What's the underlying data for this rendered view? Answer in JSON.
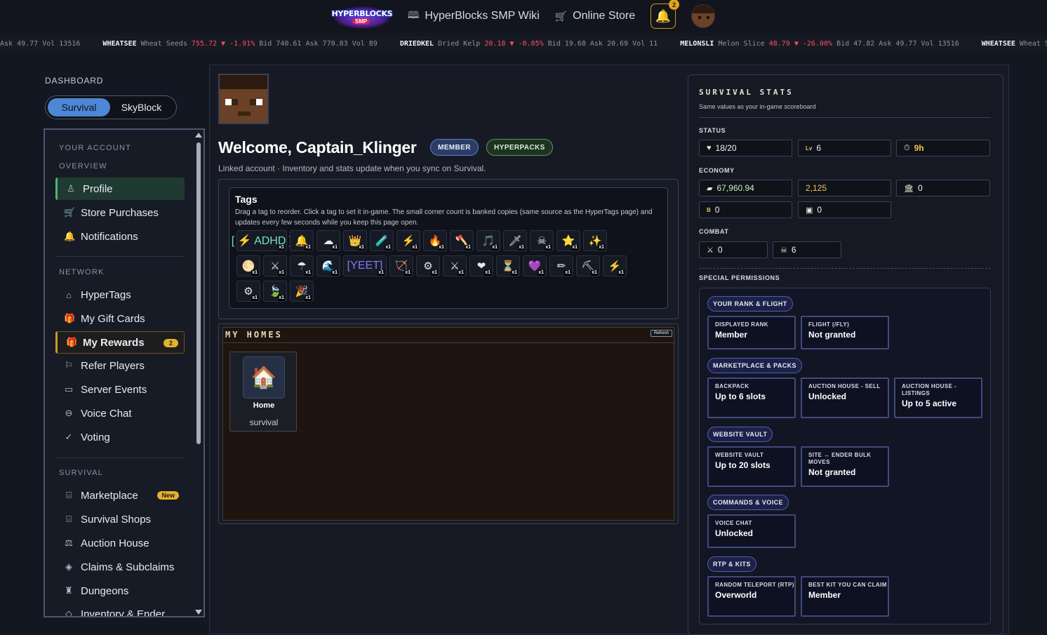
{
  "topbar": {
    "logo_line1": "HYPERBLOCKS",
    "logo_line2": "SMP",
    "wiki_label": "HyperBlocks SMP Wiki",
    "store_label": "Online Store",
    "notification_count": "2",
    "icons": {
      "wiki": "book-icon",
      "store": "cart-icon",
      "bell": "bell-icon"
    }
  },
  "ticker": [
    {
      "sym": "",
      "name": "",
      "price": "",
      "chg": "",
      "rest": "Ask 49.77 Vol 13516"
    },
    {
      "sym": "WHEATSEE",
      "name": "Wheat Seeds",
      "price": "755.72 ▼",
      "chg": "-1.91%",
      "rest": "Bid 740.61 Ask 770.83 Vol 89"
    },
    {
      "sym": "DRIEDKEL",
      "name": "Dried Kelp",
      "price": "20.18 ▼",
      "chg": "-0.05%",
      "rest": "Bid 19.68 Ask 20.69 Vol 11"
    },
    {
      "sym": "MELONSLI",
      "name": "Melon Slice",
      "price": "48.79 ▼",
      "chg": "-26.00%",
      "rest": "Bid 47.82 Ask 49.77 Vol 13516"
    },
    {
      "sym": "WHEATSEE",
      "name": "Wheat S",
      "price": "",
      "chg": "",
      "rest": ""
    }
  ],
  "sidebar": {
    "dashboard_label": "DASHBOARD",
    "mode_active": "Survival",
    "mode_other": "SkyBlock",
    "your_account": "YOUR ACCOUNT",
    "overview": "OVERVIEW",
    "network": "NETWORK",
    "survival": "SURVIVAL",
    "items": {
      "profile": "Profile",
      "store_purchases": "Store Purchases",
      "notifications": "Notifications",
      "hypertags": "HyperTags",
      "gift_cards": "My Gift Cards",
      "rewards": "My Rewards",
      "rewards_badge": "2",
      "refer": "Refer Players",
      "events": "Server Events",
      "voice": "Voice Chat",
      "voting": "Voting",
      "marketplace": "Marketplace",
      "marketplace_badge": "New",
      "shops": "Survival Shops",
      "auction": "Auction House",
      "claims": "Claims & Subclaims",
      "dungeons": "Dungeons",
      "inventory": "Inventory & Ender"
    }
  },
  "profile": {
    "welcome": "Welcome, Captain_Klinger",
    "badge_member": "MEMBER",
    "badge_hyper": "HYPERPACKS",
    "linked_text": "Linked account · Inventory and stats update when you sync on Survival."
  },
  "tags": {
    "title": "Tags",
    "help": "Drag a tag to reorder. Click a tag to set it in-game. The small corner count is banked copies (same source as the HyperTags page) and updates every few seconds while you keep this page open.",
    "text_tag_adhd": "[ ⚡ ADHD ]",
    "text_tag_yeet": "[YEET]",
    "count_label": "x1"
  },
  "homes": {
    "title": "MY HOMES",
    "refresh": "Refresh",
    "home_name": "Home",
    "home_world": "survival"
  },
  "stats": {
    "title": "SURVIVAL STATS",
    "subtitle": "Same values as your in-game scoreboard",
    "status_label": "STATUS",
    "health": "18/20",
    "level": "6",
    "level_prefix": "Lv",
    "time": "9h",
    "economy_label": "ECONOMY",
    "coins": "67,960.94",
    "gold": "2,125",
    "bank": "0",
    "b_value": "0",
    "b_prefix": "B",
    "card_value": "0",
    "combat_label": "COMBAT",
    "kills": "0",
    "deaths": "6",
    "special_label": "SPECIAL PERMISSIONS"
  },
  "permissions": {
    "rank_flight": "YOUR RANK & FLIGHT",
    "displayed_rank_l": "DISPLAYED RANK",
    "displayed_rank_v": "Member",
    "flight_l": "FLIGHT (/FLY)",
    "flight_v": "Not granted",
    "market_packs": "MARKETPLACE & PACKS",
    "backpack_l": "BACKPACK",
    "backpack_v": "Up to 6 slots",
    "ah_sell_l": "AUCTION HOUSE - SELL",
    "ah_sell_v": "Unlocked",
    "ah_list_l": "AUCTION HOUSE - LISTINGS",
    "ah_list_v": "Up to 5 active",
    "website_vault": "WEBSITE VAULT",
    "vault_l": "WEBSITE VAULT",
    "vault_v": "Up to 20 slots",
    "ender_l": "SITE ↔ ENDER BULK MOVES",
    "ender_v": "Not granted",
    "cmd_voice": "COMMANDS & VOICE",
    "voice_l": "VOICE CHAT",
    "voice_v": "Unlocked",
    "rtp_kits": "RTP & KITS",
    "rtp_l": "RANDOM TELEPORT (RTP)",
    "rtp_v": "Overworld",
    "kit_l": "BEST KIT YOU CAN CLAIM",
    "kit_v": "Member"
  },
  "colors": {
    "accent_blue": "#4d87d6",
    "accent_gold": "#e4b12c",
    "active_green": "#4fb56f",
    "down_red": "#ff4d5e"
  }
}
